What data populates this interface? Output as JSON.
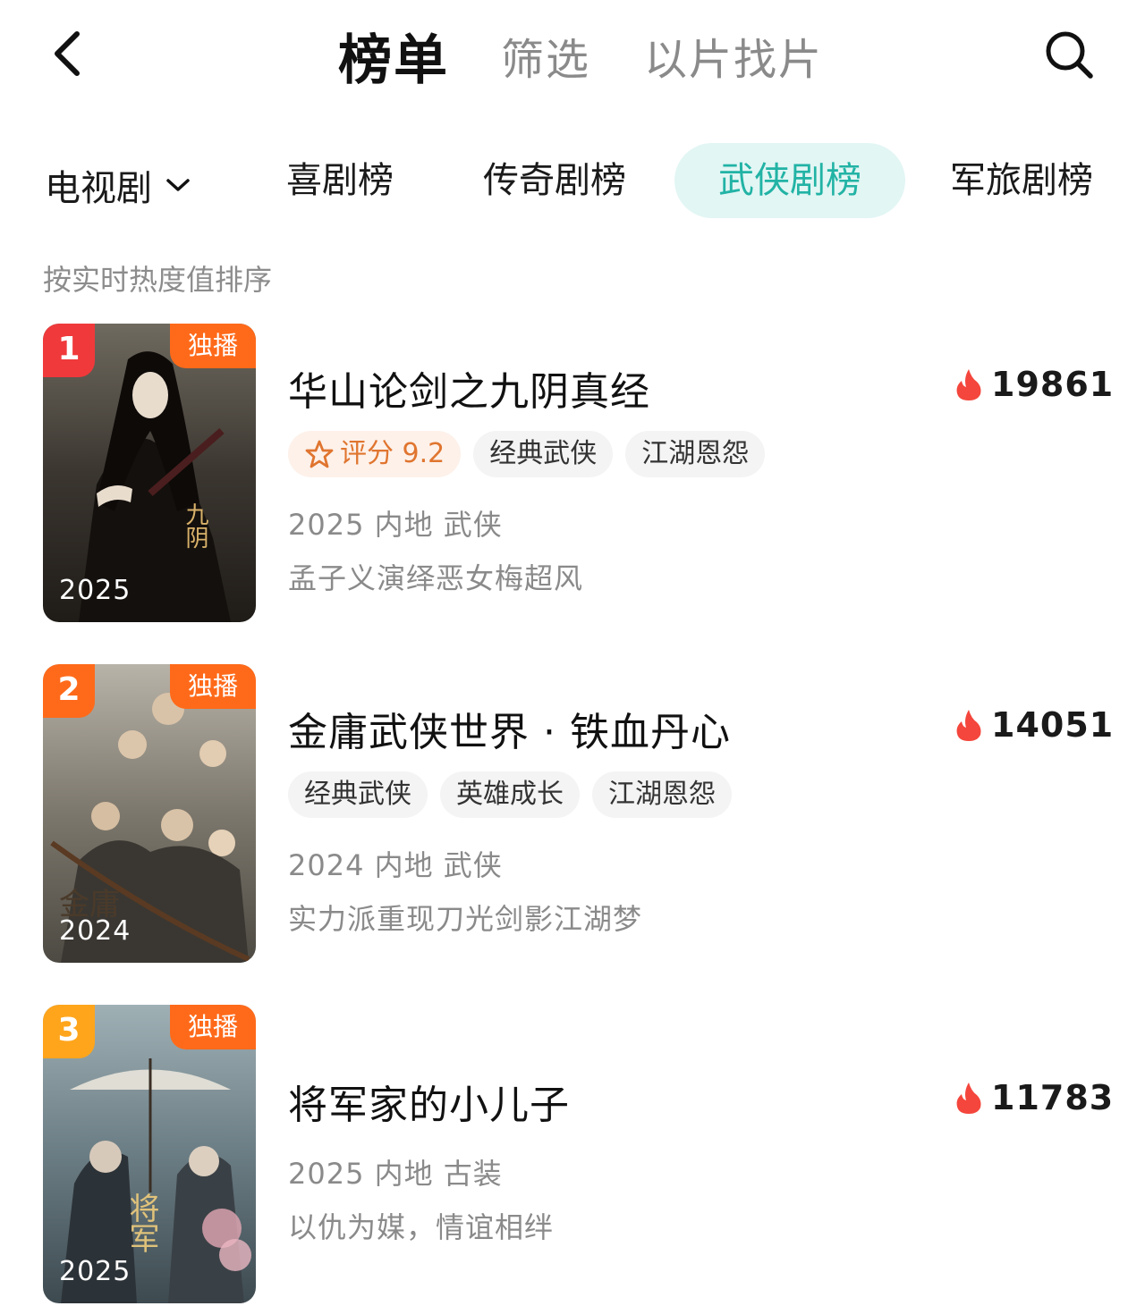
{
  "header": {
    "tabs": [
      {
        "label": "榜单"
      },
      {
        "label": "筛选"
      },
      {
        "label": "以片找片"
      }
    ]
  },
  "category": {
    "type_label": "电视剧",
    "tabs": [
      {
        "label": "喜剧榜"
      },
      {
        "label": "传奇剧榜"
      },
      {
        "label": "武侠剧榜"
      },
      {
        "label": "军旅剧榜"
      }
    ]
  },
  "sort_hint": "按实时热度值排序",
  "items": [
    {
      "rank": "1",
      "exclusive": "独播",
      "poster_year": "2025",
      "title": "华山论剑之九阴真经",
      "heat": "19861",
      "rating_label": "评分 9.2",
      "tags": [
        "经典武侠",
        "江湖恩怨"
      ],
      "meta": "2025 内地 武侠",
      "desc": "孟子义演绎恶女梅超风"
    },
    {
      "rank": "2",
      "exclusive": "独播",
      "poster_year": "2024",
      "title": "金庸武侠世界 · 铁血丹心",
      "heat": "14051",
      "tags": [
        "经典武侠",
        "英雄成长",
        "江湖恩怨"
      ],
      "meta": "2024 内地 武侠",
      "desc": "实力派重现刀光剑影江湖梦"
    },
    {
      "rank": "3",
      "exclusive": "独播",
      "poster_year": "2025",
      "title": "将军家的小儿子",
      "heat": "11783",
      "meta": "2025 内地 古装",
      "desc": "以仇为媒，情谊相绊"
    }
  ],
  "colors": {
    "accent": "#22b3a5",
    "accent_bg": "#e2f6f4",
    "rank_1": "#f0393b",
    "rank_2": "#ff6a1a",
    "rank_3": "#ffa51c",
    "exclusive": "#ff6a1a",
    "heat_flame": "#f4463c",
    "rating_text": "#e0752f"
  },
  "icons": {
    "back": "chevron-left-icon",
    "search": "search-icon",
    "dropdown": "chevron-down-icon",
    "heat": "flame-icon",
    "rating": "star-outline-icon"
  }
}
